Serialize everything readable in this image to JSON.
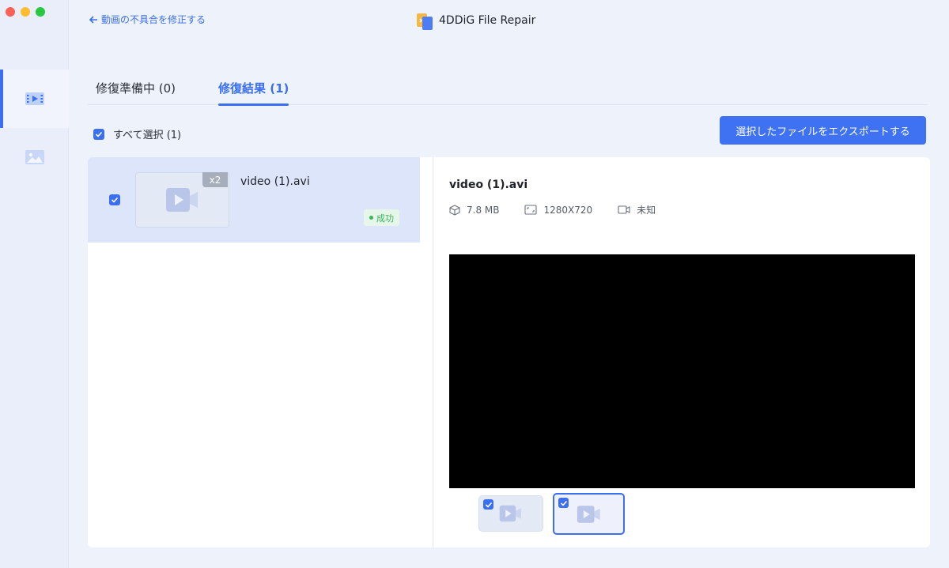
{
  "window": {
    "app_title": "4DDiG File Repair",
    "back_label": "動画の不具合を修正する"
  },
  "sidebar": {
    "items": [
      {
        "name": "video-repair",
        "icon": "video-repair-icon",
        "active": true
      },
      {
        "name": "photo-repair",
        "icon": "photo-icon",
        "active": false
      }
    ]
  },
  "tabs": [
    {
      "label": "修復準備中 (0)",
      "active": false
    },
    {
      "label": "修復結果 (1)",
      "active": true
    }
  ],
  "toolbar": {
    "select_all_label": "すべて選択 (1)",
    "select_all_checked": true,
    "export_label": "選択したファイルをエクスポートする"
  },
  "file_list": [
    {
      "name": "video (1).avi",
      "count_badge": "x2",
      "status": "成功",
      "checked": true
    }
  ],
  "detail": {
    "title": "video (1).avi",
    "size": "7.8 MB",
    "resolution": "1280X720",
    "duration": "未知"
  },
  "colors": {
    "accent": "#3a6ff0",
    "success": "#39b55a",
    "selected_row": "#dde5fa"
  }
}
